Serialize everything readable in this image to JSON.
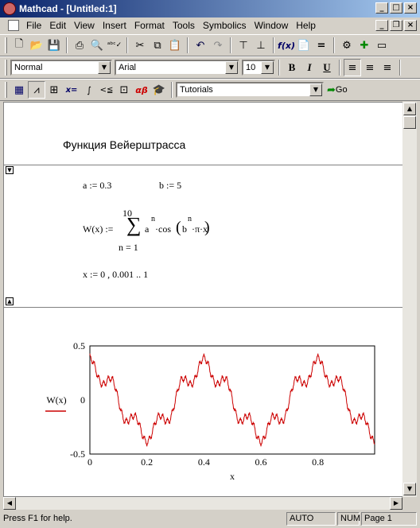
{
  "window": {
    "title": "Mathcad - [Untitled:1]"
  },
  "menu": [
    "File",
    "Edit",
    "View",
    "Insert",
    "Format",
    "Tools",
    "Symbolics",
    "Window",
    "Help"
  ],
  "format": {
    "style": "Normal",
    "font": "Arial",
    "size": "10"
  },
  "resources": {
    "value": "Tutorials",
    "go": "Go"
  },
  "doc": {
    "heading": "Функция Вейерштрасса",
    "def_a": "a := 0.3",
    "def_b": "b := 5",
    "w_lhs": "W(x) :=",
    "sum_upper": "10",
    "sum_sym": "∑",
    "sum_lower": "n = 1",
    "term_a": "a",
    "term_n": "n",
    "term_cos": "·cos",
    "term_b": "b",
    "term_n2": "n",
    "term_rest": "·π·x",
    "range": "x := 0 , 0.001 .. 1"
  },
  "chart_data": {
    "type": "line",
    "legend": "W(x)",
    "xlabel": "x",
    "xlim": [
      0,
      0.999
    ],
    "ylim": [
      -0.5,
      0.5
    ],
    "xticks": [
      "0",
      "0.2",
      "0.4",
      "0.6",
      "0.8"
    ],
    "yticks": [
      "0.5",
      "0",
      "-0.5"
    ],
    "series_color": "#cc0000",
    "a": 0.3,
    "b": 5,
    "n_max": 10
  },
  "status": {
    "help": "Press F1 for help.",
    "mode": "AUTO",
    "num": "NUM",
    "page": "Page 1"
  }
}
